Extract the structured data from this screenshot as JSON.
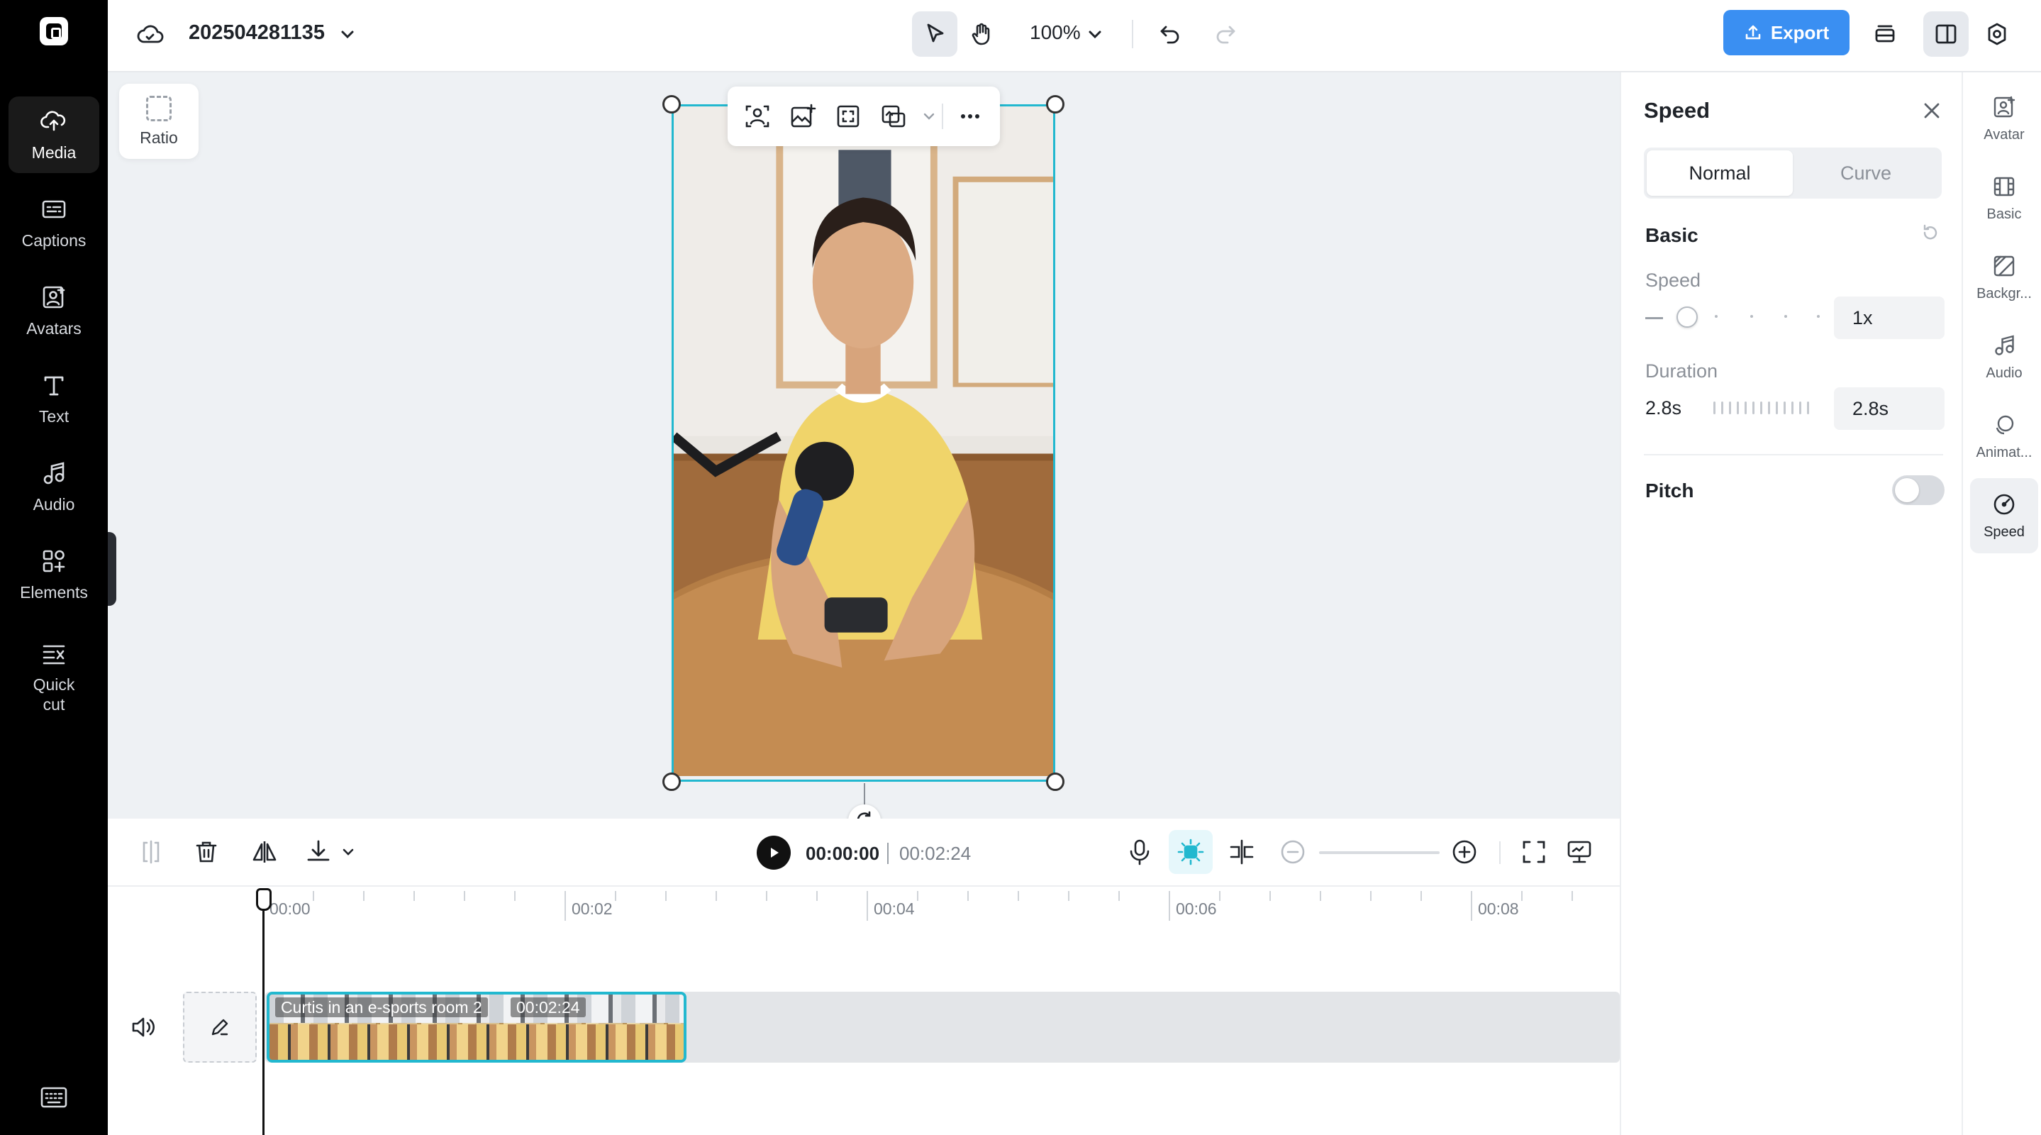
{
  "app": {
    "project_name": "202504281135",
    "zoom": "100%",
    "export_label": "Export"
  },
  "left_sidebar": {
    "items": [
      {
        "label": "Media",
        "icon": "cloud-upload-icon",
        "active": true
      },
      {
        "label": "Captions",
        "icon": "captions-icon"
      },
      {
        "label": "Avatars",
        "icon": "avatar-icon"
      },
      {
        "label": "Text",
        "icon": "text-icon"
      },
      {
        "label": "Audio",
        "icon": "music-note-icon"
      },
      {
        "label": "Elements",
        "icon": "elements-icon"
      },
      {
        "label": "Quick cut",
        "icon": "quick-cut-icon"
      }
    ]
  },
  "canvas": {
    "ratio_label": "Ratio"
  },
  "timeline": {
    "current_time": "00:00:00",
    "total_time": "00:02:24",
    "ruler_labels": [
      "00:00",
      "00:02",
      "00:04",
      "00:06",
      "00:08"
    ],
    "clip": {
      "name": "Curtis in an e-sports room 2",
      "duration": "00:02:24"
    }
  },
  "speed_panel": {
    "title": "Speed",
    "tabs": [
      {
        "label": "Normal",
        "active": true
      },
      {
        "label": "Curve",
        "active": false
      }
    ],
    "section_basic": "Basic",
    "speed_label": "Speed",
    "speed_value": "1x",
    "speed_slider_fraction": 0.1,
    "duration_label": "Duration",
    "duration_text": "2.8s",
    "duration_value": "2.8s",
    "pitch_label": "Pitch",
    "pitch_enabled": false
  },
  "right_rail": {
    "items": [
      {
        "label": "Avatar",
        "icon": "avatar-icon"
      },
      {
        "label": "Basic",
        "icon": "basic-icon"
      },
      {
        "label": "Backgr...",
        "icon": "background-icon"
      },
      {
        "label": "Audio",
        "icon": "music-note-icon"
      },
      {
        "label": "Animat...",
        "icon": "animation-icon"
      },
      {
        "label": "Speed",
        "icon": "speed-icon",
        "active": true
      }
    ]
  },
  "colors": {
    "accent": "#22b8cf",
    "export": "#3a8ff2"
  }
}
